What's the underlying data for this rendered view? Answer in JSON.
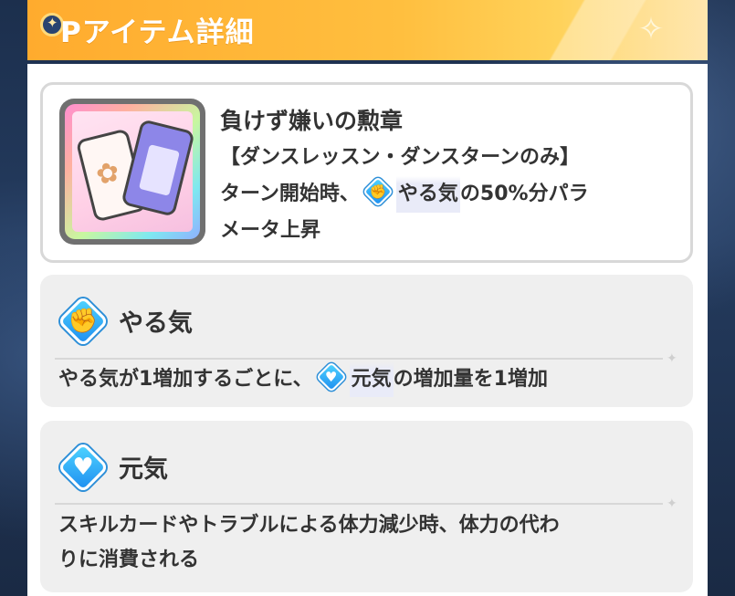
{
  "header": {
    "title": "Pアイテム詳細"
  },
  "item": {
    "name": "負けず嫌いの勲章",
    "condition": "【ダンスレッスン・ダンスターンのみ】",
    "effect_prefix": "ターン開始時、",
    "effect_keyword": "やる気",
    "effect_suffix": "の50%分パラ",
    "effect_line3": "メータ上昇"
  },
  "keywords": [
    {
      "icon": "fist-icon",
      "title": "やる気",
      "text_prefix": "やる気が1増加するごとに、",
      "text_keyword": "元気",
      "text_suffix": "の増加量を1増加"
    },
    {
      "icon": "heart-drop-icon",
      "title": "元気",
      "text_line1": "スキルカードやトラブルによる体力減少時、体力の代わ",
      "text_line2": "りに消費される"
    }
  ],
  "colors": {
    "header_orange": "#ffab2e",
    "keyword_blue": "#1f8ff0",
    "card_bg": "#efefef"
  }
}
